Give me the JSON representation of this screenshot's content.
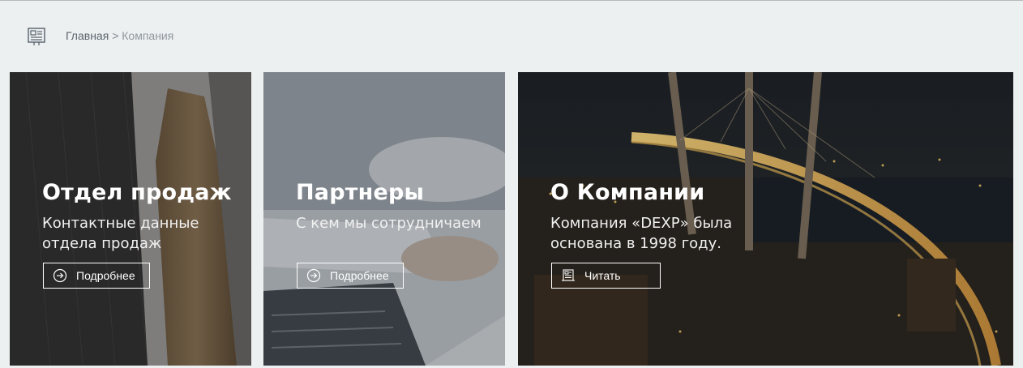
{
  "breadcrumb": {
    "icon": "document-icon",
    "home": "Главная",
    "separator": ">",
    "current": "Компания"
  },
  "cards": [
    {
      "title": "Отдел продаж",
      "text_line1": "Контактные данные",
      "text_line2": "отдела продаж",
      "button_label": "Подробнее",
      "button_icon": "arrow-circle-icon"
    },
    {
      "title": "Партнеры",
      "text_line1": "С кем мы сотрудничаем",
      "text_line2": "",
      "button_label": "Подробнее",
      "button_icon": "arrow-circle-icon"
    },
    {
      "title": "О Компании",
      "text_line1": "Компания «DEXP» была",
      "text_line2": "основана в 1998 году.",
      "button_label": "Читать",
      "button_icon": "newspaper-icon"
    }
  ]
}
